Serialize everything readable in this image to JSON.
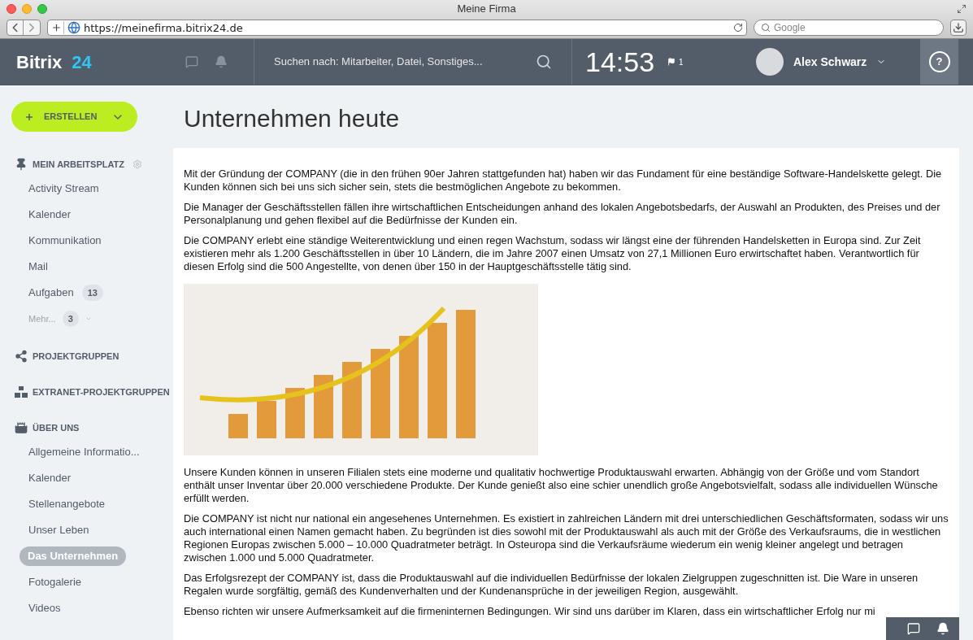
{
  "browser": {
    "title": "Meine Firma",
    "url": "https://meinefirma.bitrix24.de",
    "search_placeholder": "Google"
  },
  "header": {
    "logo_name": "Bitrix",
    "logo_number": "24",
    "search_placeholder": "Suchen nach: Mitarbeiter, Datei, Sonstiges...",
    "time": "14:53",
    "flag_count": "1",
    "user_name": "Alex Schwarz",
    "help": "?"
  },
  "sidebar": {
    "create_button": "ERSTELLEN",
    "sections": [
      {
        "title": "MEIN ARBEITSPLATZ",
        "settings": true,
        "items": [
          {
            "label": "Activity Stream",
            "selected": false
          },
          {
            "label": "Kalender",
            "selected": false
          },
          {
            "label": "Kommunikation",
            "selected": false
          },
          {
            "label": "Mail",
            "selected": false
          },
          {
            "label": "Aufgaben",
            "selected": false,
            "badge": "13"
          },
          {
            "label": "Mehr...",
            "selected": false,
            "badge": "3",
            "kind": "more"
          }
        ]
      },
      {
        "title": "PROJEKTGRUPPEN",
        "settings": false
      },
      {
        "title": "EXTRANET-PROJEKTGRUPPEN",
        "settings": false
      },
      {
        "title": "ÜBER UNS",
        "settings": false,
        "items": [
          {
            "label": "Allgemeine Informatio...",
            "selected": false
          },
          {
            "label": "Kalender",
            "selected": false
          },
          {
            "label": "Stellenangebote",
            "selected": false
          },
          {
            "label": "Unser Leben",
            "selected": false
          },
          {
            "label": "Das Unternehmen",
            "selected": true
          },
          {
            "label": "Fotogalerie",
            "selected": false
          },
          {
            "label": "Videos",
            "selected": false
          }
        ]
      }
    ]
  },
  "page": {
    "title": "Unternehmen heute",
    "content": [
      {
        "kind": "paragraph",
        "text": "Mit der Gründung der COMPANY (die in den frühen 90er Jahren stattgefunden hat) haben wir das Fundament für eine beständige Software-Handelskette gelegt. Die Kunden können sich  bei uns sich sicher sein, stets die bestmöglichen Angebote zu bekommen."
      },
      {
        "kind": "paragraph",
        "text": "Die Manager der Geschäftsstellen fällen ihre wirtschaftlichen Entscheidungen anhand des lokalen Angebotsbedarfs, der Auswahl an Produkten, des Preises und der Personalplanung und gehen flexibel auf die Bedürfnisse der Kunden ein."
      },
      {
        "kind": "paragraph",
        "text": "Die COMPANY erlebt eine ständige Weiterentwicklung und einen regen Wachstum, sodass wir längst eine der führenden Handelsketten in Europa sind. Zur Zeit existieren mehr als 1.200 Geschäftsstellen in über 10 Ländern, die im Jahre 2007 einen Umsatz von 27,1 Millionen Euro erwirtschaftet haben. Verantwortlich für diesen Erfolg sind die 500 Angestellte, von denen über 150 in der Hauptgeschäftsstelle tätig sind."
      },
      {
        "kind": "image"
      },
      {
        "kind": "paragraph",
        "text": "Unsere Kunden können in unseren Filialen stets eine moderne und qualitativ hochwertige Produktauswahl erwarten. Abhängig von der Größe und vom Standort enthält unser Inventar über 20.000 verschiedene Produkte. Der Kunde genießt also eine schier unendlich große Angebotsvielfalt, sodass alle individuellen Wünsche erfüllt werden."
      },
      {
        "kind": "paragraph",
        "text": "Die COMPANY ist nicht nur national ein angesehenes Unternehmen. Es existiert in zahlreichen Ländern mit drei unterschiedlichen Geschäftsformaten, sodass wir uns auch international einen Namen gemacht haben. Zu begründen ist dies sowohl mit der Produktauswahl als auch mit der Größe des Verkaufsraums, die in westlichen Regionen Europas zwischen 5.000 – 10.000 Quadratmeter beträgt. In Osteuropa sind die Verkaufsräume wiederum ein wenig kleiner angelegt und betragen zwischen 1.000 und 5.000 Quadratmeter."
      },
      {
        "kind": "paragraph",
        "text": "Das Erfolgsrezept der COMPANY ist, dass die Produktauswahl auf die individuellen Bedürfnisse der lokalen Zielgruppen zugeschnitten ist. Die Ware in unseren Regalen wurde sorgfältig, gemäß des Kundenverhalten und der Kundenansprüche in der jeweiligen Region, ausgewählt."
      },
      {
        "kind": "paragraph",
        "text": "Ebenso richten wir unsere Aufmerksamkeit auf die firmeninternen Bedingungen. Wir sind uns darüber im Klaren, dass ein wirtschaftlicher Erfolg nur mi"
      }
    ]
  }
}
